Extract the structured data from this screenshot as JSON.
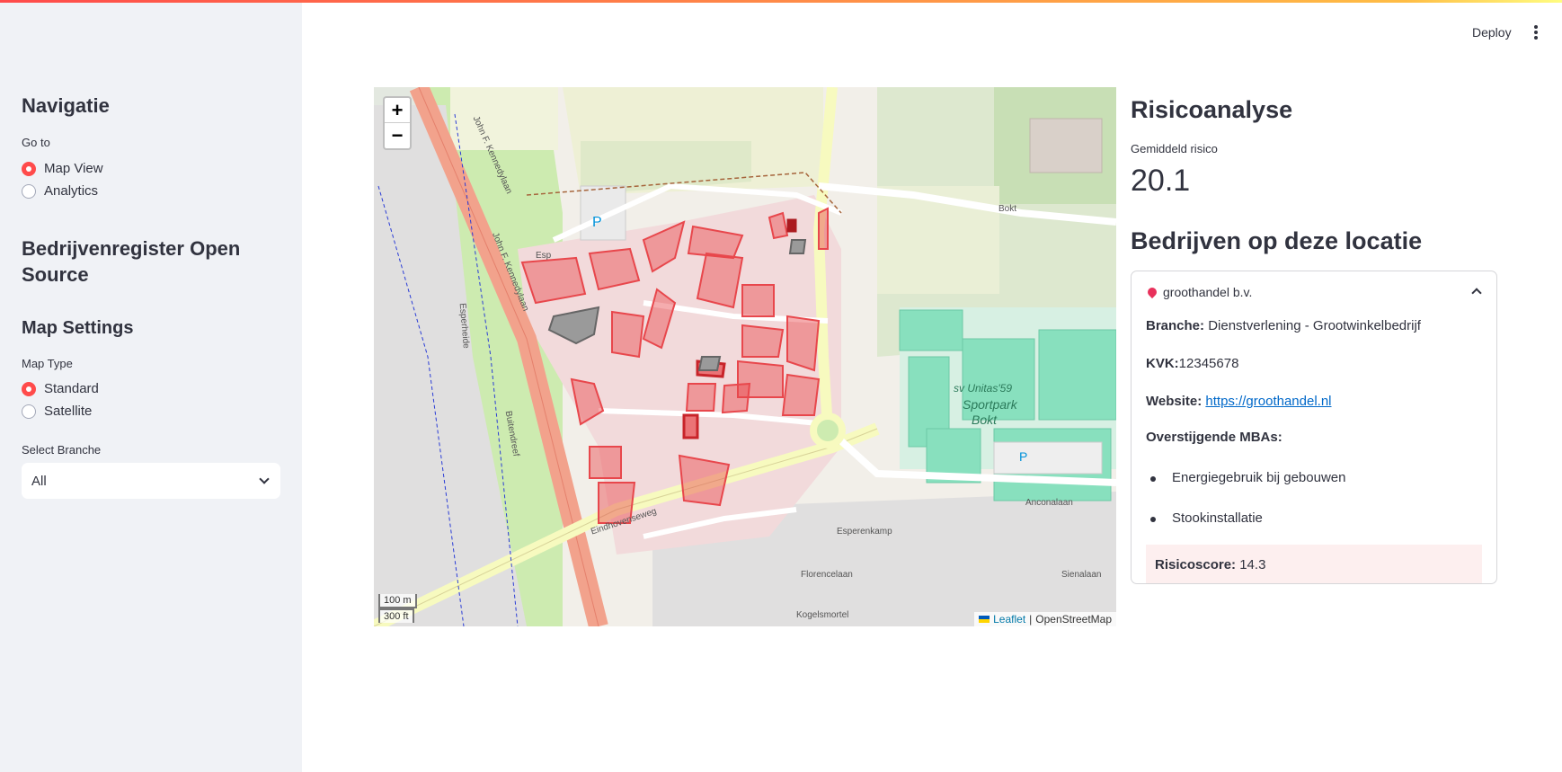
{
  "sidebar": {
    "nav_title": "Navigatie",
    "goto_label": "Go to",
    "nav_options": [
      {
        "label": "Map View",
        "selected": true
      },
      {
        "label": "Analytics",
        "selected": false
      }
    ],
    "register_title": "Bedrijvenregister Open Source",
    "settings_title": "Map Settings",
    "map_type_label": "Map Type",
    "map_type_options": [
      {
        "label": "Standard",
        "selected": true
      },
      {
        "label": "Satellite",
        "selected": false
      }
    ],
    "branche_label": "Select Branche",
    "branche_value": "All"
  },
  "header": {
    "deploy_label": "Deploy",
    "menu_icon": "kebab-menu-icon"
  },
  "map": {
    "zoom_in": "+",
    "zoom_out": "−",
    "scale_metric": "100 m",
    "scale_imperial": "300 ft",
    "attribution_link": "Leaflet",
    "attribution_sep": "|",
    "attribution_text": "OpenStreetMap",
    "labels": {
      "kennedylaan_1": "John F. Kennedylaan",
      "kennedylaan_2": "John F. Kennedylaan",
      "esp": "Esp",
      "bokt": "Bokt",
      "eindhovenseweg": "Eindhovenseweg",
      "sv_unitas": "sv Unitas'59",
      "sportpark": "Sportpark",
      "sportpark_bokt": "Bokt",
      "anconalaan": "Anconalaan",
      "esperenkamp": "Esperenkamp",
      "florencelaan": "Florencelaan",
      "kogelsmortel": "Kogelsmortel",
      "buitendreef": "Buitendreef",
      "esperheide": "Esperheide",
      "sienalaan": "Sienalaan",
      "parking": "P"
    },
    "colors": {
      "building_risk": "#e8474c",
      "building_grey": "#9a9a9a",
      "sports": "#88e0be",
      "road_major": "#f2a28c",
      "road_secondary": "#f7fabf",
      "grass": "#cdebb0"
    }
  },
  "panel": {
    "title": "Risicoanalyse",
    "metric_label": "Gemiddeld risico",
    "metric_value": "20.1",
    "companies_title": "Bedrijven op deze locatie",
    "company": {
      "name": "groothandel b.v.",
      "branche_label": "Branche:",
      "branche_value": "Dienstverlening - Grootwinkelbedrijf",
      "kvk_label": "KVK:",
      "kvk_value": "12345678",
      "website_label": "Website:",
      "website_value": "https://groothandel.nl",
      "mba_label": "Overstijgende MBAs:",
      "mbas": [
        "Energiegebruik bij gebouwen",
        "Stookinstallatie"
      ],
      "score_label": "Risicoscore:",
      "score_value": "14.3"
    }
  }
}
